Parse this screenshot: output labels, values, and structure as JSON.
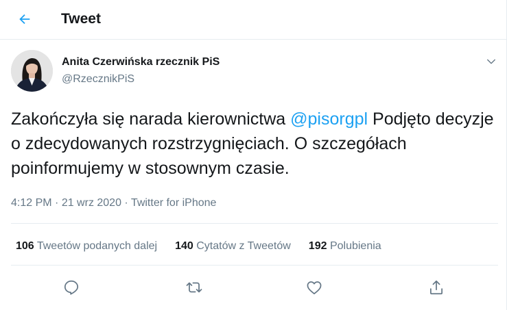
{
  "header": {
    "title": "Tweet",
    "back_icon": "arrow-left-icon",
    "accent_color": "#1da1f2"
  },
  "tweet": {
    "author": {
      "name": "Anita Czerwińska rzecznik PiS",
      "handle": "@RzecznikPiS"
    },
    "text_part1": "Zakończyła się narada kierownictwa ",
    "mention": "@pisorgpl",
    "text_part2": " Podjęto decyzje o zdecydowanych rozstrzygnięciach. O szczegółach poinformujemy w stosownym czasie.",
    "time": "4:12 PM",
    "date": "21 wrz 2020",
    "source": "Twitter for iPhone",
    "separator": " · "
  },
  "stats": {
    "retweets_count": "106",
    "retweets_label": "Tweetów podanych dalej",
    "quotes_count": "140",
    "quotes_label": "Cytatów z Tweetów",
    "likes_count": "192",
    "likes_label": "Polubienia"
  },
  "actions": [
    "reply-icon",
    "retweet-icon",
    "like-icon",
    "share-icon"
  ],
  "colors": {
    "text_primary": "#14171a",
    "text_secondary": "#657786",
    "divider": "#e6ecf0",
    "mention": "#1da1f2"
  }
}
